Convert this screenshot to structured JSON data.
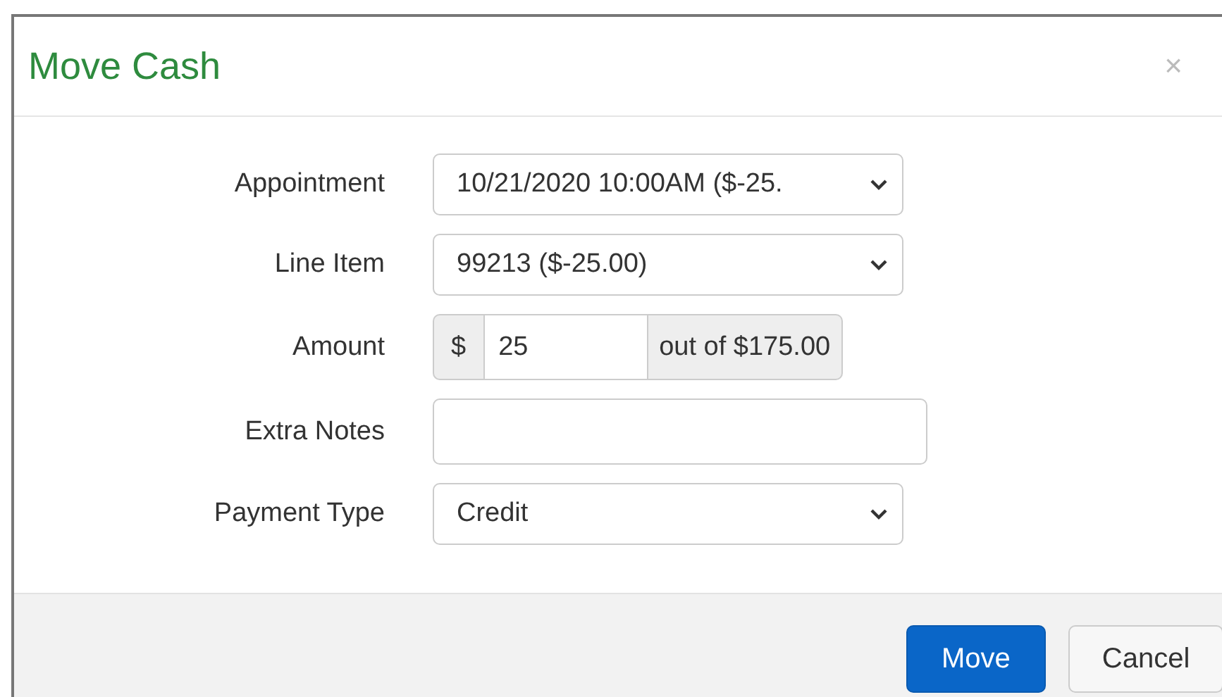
{
  "dialog": {
    "title": "Move Cash",
    "close": "×"
  },
  "fields": [
    {
      "kind": "select",
      "label": "Appointment",
      "value": "10/21/2020 10:00AM ($-25."
    },
    {
      "kind": "select",
      "label": "Line Item",
      "value": "99213 ($-25.00)"
    },
    {
      "kind": "amount",
      "label": "Amount",
      "prefix": "$",
      "value": "25",
      "suffix": "out of $175.00"
    },
    {
      "kind": "text",
      "label": "Extra Notes"
    },
    {
      "kind": "select",
      "label": "Payment Type",
      "value": "Credit"
    }
  ],
  "buttons": [
    {
      "label": "Move",
      "kind": "primary"
    },
    {
      "label": "Cancel",
      "kind": "default"
    }
  ]
}
